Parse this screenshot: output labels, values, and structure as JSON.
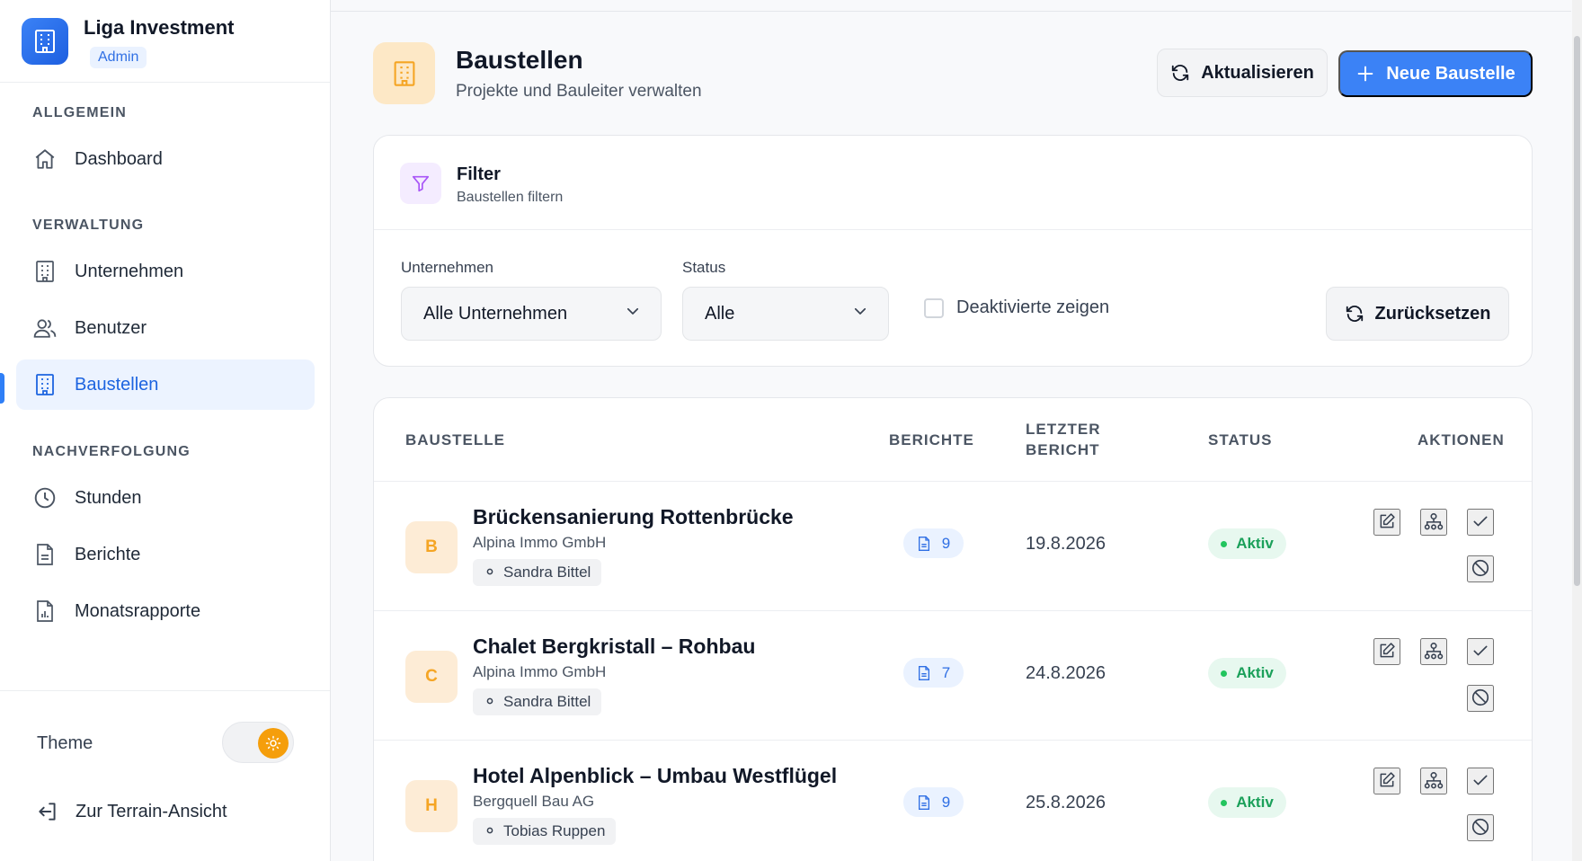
{
  "brand": {
    "title": "Liga Investment",
    "badge": "Admin"
  },
  "sidebar": {
    "sections": [
      {
        "label": "ALLGEMEIN"
      },
      {
        "label": "VERWALTUNG"
      },
      {
        "label": "NACHVERFOLGUNG"
      }
    ],
    "items": [
      {
        "label": "Dashboard",
        "icon": "home-icon"
      },
      {
        "label": "Unternehmen",
        "icon": "building-icon"
      },
      {
        "label": "Benutzer",
        "icon": "users-icon"
      },
      {
        "label": "Baustellen",
        "icon": "building-icon",
        "active": true
      },
      {
        "label": "Stunden",
        "icon": "clock-icon"
      },
      {
        "label": "Berichte",
        "icon": "document-icon"
      },
      {
        "label": "Monatsrapporte",
        "icon": "report-chart-icon"
      }
    ],
    "theme_label": "Theme",
    "theme_mode": "light",
    "terrain_label": "Zur Terrain-Ansicht"
  },
  "header": {
    "title": "Baustellen",
    "subtitle": "Projekte und Bauleiter verwalten",
    "refresh_label": "Aktualisieren",
    "new_label": "Neue Baustelle"
  },
  "filter": {
    "title": "Filter",
    "subtitle": "Baustellen filtern",
    "company_label": "Unternehmen",
    "company_value": "Alle Unternehmen",
    "status_label": "Status",
    "status_value": "Alle",
    "show_disabled_label": "Deaktivierte zeigen",
    "show_disabled_checked": false,
    "reset_label": "Zurücksetzen"
  },
  "table": {
    "columns": {
      "site": "BAUSTELLE",
      "reports": "BERICHTE",
      "last_report_1": "LETZTER",
      "last_report_2": "BERICHT",
      "status": "STATUS",
      "actions": "AKTIONEN"
    },
    "rows": [
      {
        "initial": "B",
        "name": "Brückensanierung Rottenbrücke",
        "company": "Alpina Immo GmbH",
        "manager": "Sandra Bittel",
        "reports": "9",
        "last_report": "19.8.2026",
        "status": "Aktiv"
      },
      {
        "initial": "C",
        "name": "Chalet Bergkristall – Rohbau",
        "company": "Alpina Immo GmbH",
        "manager": "Sandra Bittel",
        "reports": "7",
        "last_report": "24.8.2026",
        "status": "Aktiv"
      },
      {
        "initial": "H",
        "name": "Hotel Alpenblick – Umbau Westflügel",
        "company": "Bergquell Bau AG",
        "manager": "Tobias Ruppen",
        "reports": "9",
        "last_report": "25.8.2026",
        "status": "Aktiv"
      }
    ]
  },
  "colors": {
    "primary": "#3b82f6",
    "active_nav_bg": "#ecf3ff",
    "status_active": "#1ba05a",
    "avatar_accent": "#f5a524"
  }
}
